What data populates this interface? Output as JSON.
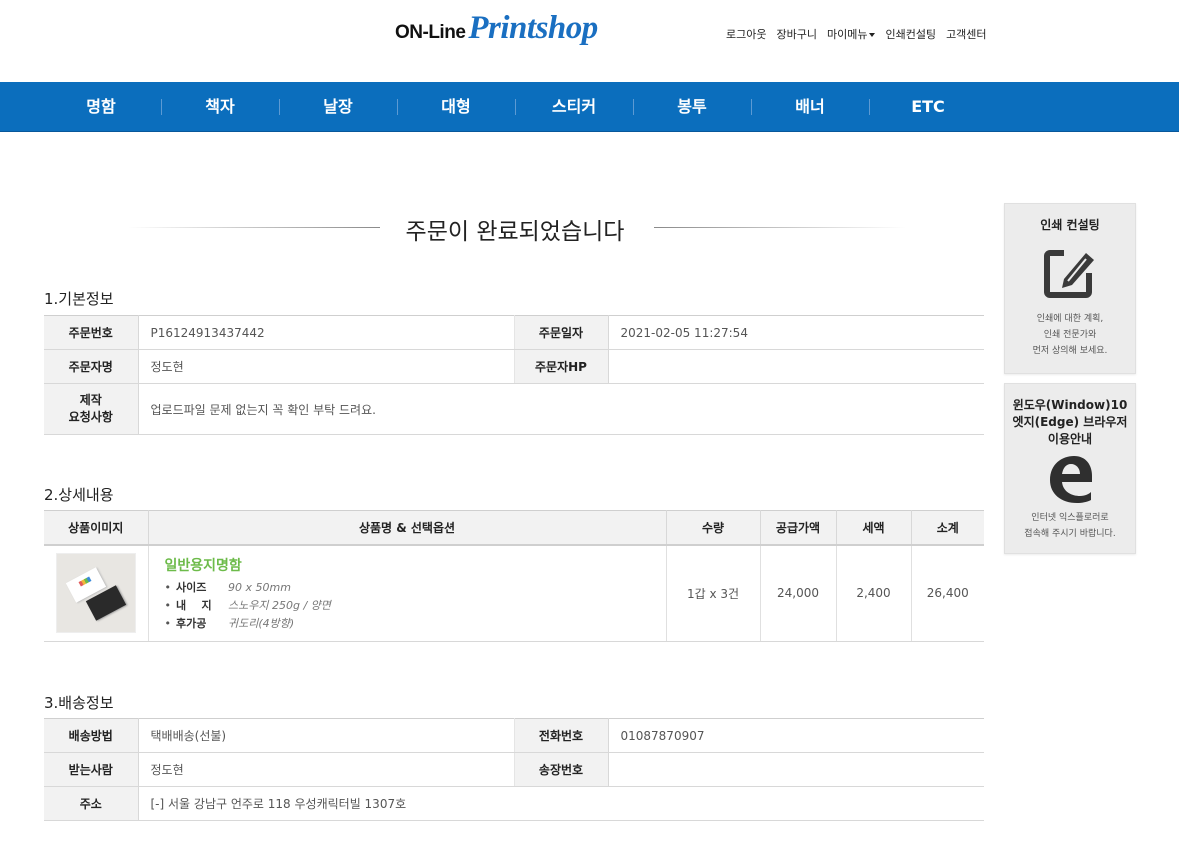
{
  "header": {
    "logo_prefix": "ON-Line",
    "logo_main": "Printshop",
    "top_menu": [
      "로그아웃",
      "장바구니",
      "마이메뉴",
      "인쇄컨설팅",
      "고객센터"
    ]
  },
  "gnb": [
    "명함",
    "책자",
    "날장",
    "대형",
    "스티커",
    "봉투",
    "배너",
    "ETC"
  ],
  "page_title": "주문이 완료되었습니다",
  "basic": {
    "section_title": "1.기본정보",
    "order_no_label": "주문번호",
    "order_no": "P16124913437442",
    "order_date_label": "주문일자",
    "order_date": "2021-02-05 11:27:54",
    "orderer_label": "주문자명",
    "orderer": "정도현",
    "orderer_hp_label": "주문자HP",
    "orderer_hp": "",
    "request_label_1": "제작",
    "request_label_2": "요청사항",
    "request": "업로드파일 문제 없는지 꼭 확인 부탁 드려요."
  },
  "detail": {
    "section_title": "2.상세내용",
    "headers": [
      "상품이미지",
      "상품명 & 선택옵션",
      "수량",
      "공급가액",
      "세액",
      "소계"
    ],
    "product_name": "일반용지명함",
    "options": [
      {
        "label": "사이즈",
        "value": "90 x 50mm"
      },
      {
        "label": "내    지",
        "value": "스노우지 250g / 양면"
      },
      {
        "label": "후가공",
        "value": "귀도리(4방향)"
      }
    ],
    "qty": "1갑 x 3건",
    "supply": "24,000",
    "tax": "2,400",
    "subtotal": "26,400"
  },
  "delivery": {
    "section_title": "3.배송정보",
    "method_label": "배송방법",
    "method": "택배배송(선불)",
    "phone_label": "전화번호",
    "phone": "01087870907",
    "receiver_label": "받는사람",
    "receiver": "정도현",
    "invoice_label": "송장번호",
    "invoice": "",
    "address_label": "주소",
    "address": "[-] 서울 강남구 언주로 118 우성캐릭터빌 1307호"
  },
  "sidebar": {
    "consult_title": "인쇄 컨설팅",
    "consult_desc": [
      "인쇄에 대한 계획,",
      "인쇄 전문가와",
      "먼저 상의해 보세요."
    ],
    "browser_title": [
      "윈도우(Window)10",
      "엣지(Edge) 브라우저",
      "이용안내"
    ],
    "browser_desc": [
      "인터넷 익스플로러로",
      "접속해 주시기 바랍니다."
    ]
  },
  "colors": {
    "brand_blue": "#0b6ebd",
    "product_green": "#6dbb4a"
  }
}
